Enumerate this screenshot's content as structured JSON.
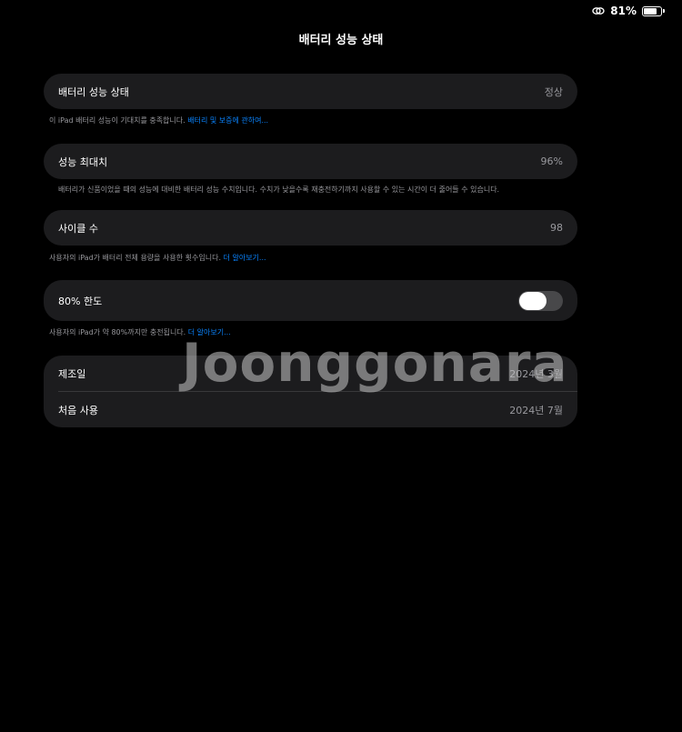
{
  "status_bar": {
    "battery_percent": "81%",
    "battery_level": 0.81,
    "icons": [
      "link-icon",
      "battery-icon"
    ]
  },
  "header": {
    "title": "배터리 성능 상태"
  },
  "battery_health": {
    "label": "배터리 성능 상태",
    "value": "정상",
    "footnote_text": "이 iPad 배터리 성능이 기대치를 충족합니다. ",
    "footnote_link": "배터리 및 보증에 관하여..."
  },
  "max_capacity": {
    "label": "성능 최대치",
    "value": "96%",
    "footnote_text": "배터리가 신품이었을 때의 성능에 대비한 배터리 성능 수치입니다. 수치가 낮을수록 재충전하기까지 사용할 수 있는 시간이 더 줄어들 수 있습니다."
  },
  "cycle_count": {
    "label": "사이클 수",
    "value": "98",
    "footnote_text": "사용자의 iPad가 배터리 전체 용량을 사용한 횟수입니다. ",
    "footnote_link": "더 알아보기..."
  },
  "limit": {
    "label": "80% 한도",
    "toggle_on": false,
    "footnote_text": "사용자의 iPad가 약 80%까지만 충전됩니다. ",
    "footnote_link": "더 알아보기..."
  },
  "dates": {
    "manufacture_label": "제조일",
    "manufacture_value": "2024년 3월",
    "first_use_label": "처음 사용",
    "first_use_value": "2024년 7월"
  },
  "watermark": "Joonggonara",
  "colors": {
    "background": "#000000",
    "card": "#1c1c1e",
    "secondary_text": "#98989d",
    "link": "#0a84ff",
    "toggle_off": "#48484a"
  }
}
